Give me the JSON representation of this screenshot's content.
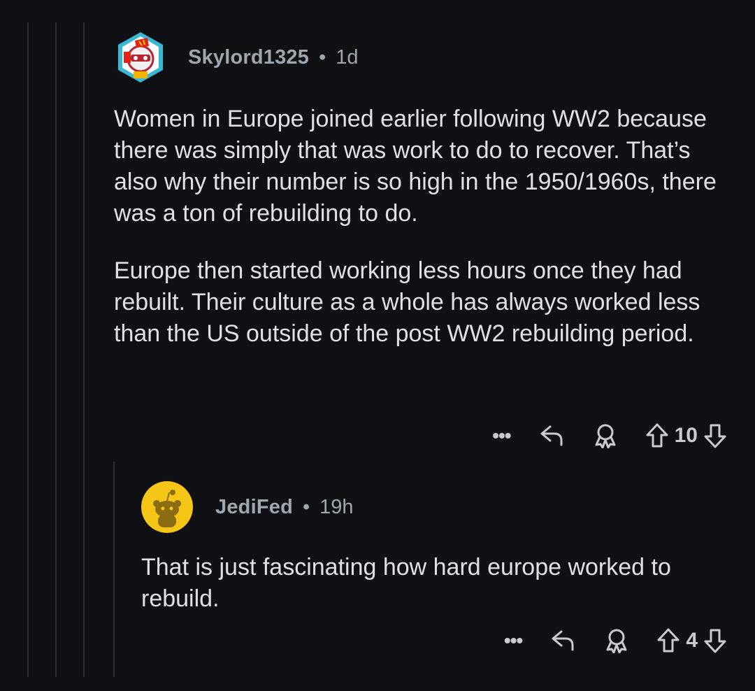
{
  "comments": [
    {
      "username": "Skylord1325",
      "age": "1d",
      "paragraphs": [
        "Women in Europe joined earlier following WW2 because there was simply that was work to do to recover. That’s also why their number is so high in the 1950/1960s, there was a ton of rebuilding to do.",
        "Europe then started working less hours once they had rebuilt. Their culture as a whole has always worked less than the US outside of the post WW2 rebuilding period."
      ],
      "score": "10",
      "avatar_icon": "avatar-badge-icon"
    },
    {
      "username": "JediFed",
      "age": "19h",
      "paragraphs": [
        "That is just fascinating how hard europe worked to rebuild."
      ],
      "score": "4",
      "avatar_icon": "snoo-avatar-icon"
    }
  ],
  "separator": "•",
  "more_label": "•••",
  "colors": {
    "background": "#0e1013",
    "text": "#dfe2e4",
    "meta": "#9fa6ad",
    "avatar_yellow": "#f5c518"
  }
}
